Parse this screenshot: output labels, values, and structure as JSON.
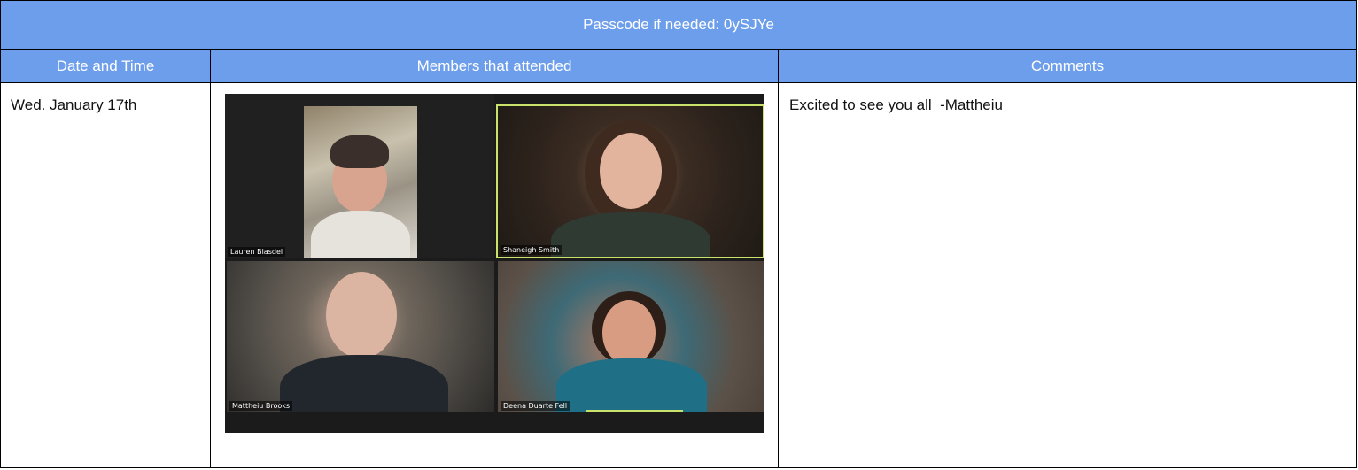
{
  "banner": {
    "passcode_label": "Passcode if needed: 0ySJYe"
  },
  "columns": [
    "Date and Time",
    "Members that attended",
    "Comments"
  ],
  "rows": [
    {
      "date": "Wed. January 17th",
      "comment": "Excited to see you all  -Mattheiu",
      "participants": [
        "Lauren Blasdel",
        "Shaneigh Smith",
        "Mattheiu Brooks",
        "Deena Duarte Fell"
      ]
    }
  ],
  "colors": {
    "header_bg": "#6d9eeb",
    "active_speaker": "#c9e26a"
  }
}
